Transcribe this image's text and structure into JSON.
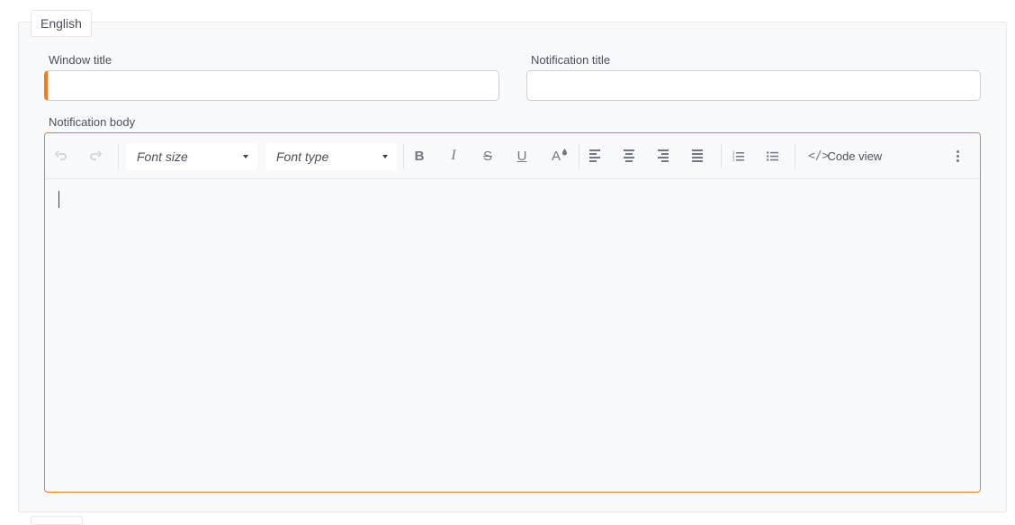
{
  "language_tab": "English",
  "fields": {
    "window_title": {
      "label": "Window title",
      "value": ""
    },
    "notification_title": {
      "label": "Notification title",
      "value": ""
    },
    "notification_body": {
      "label": "Notification body"
    }
  },
  "toolbar": {
    "font_size_placeholder": "Font size",
    "font_type_placeholder": "Font type",
    "bold": "B",
    "italic": "I",
    "strike": "S",
    "underline": "U",
    "font_color": "A",
    "code_icon": "</>",
    "code_view": "Code view"
  },
  "colors": {
    "accent": "#f07c1c",
    "panel": "#f8f9fb",
    "border": "#e3e6ec"
  }
}
